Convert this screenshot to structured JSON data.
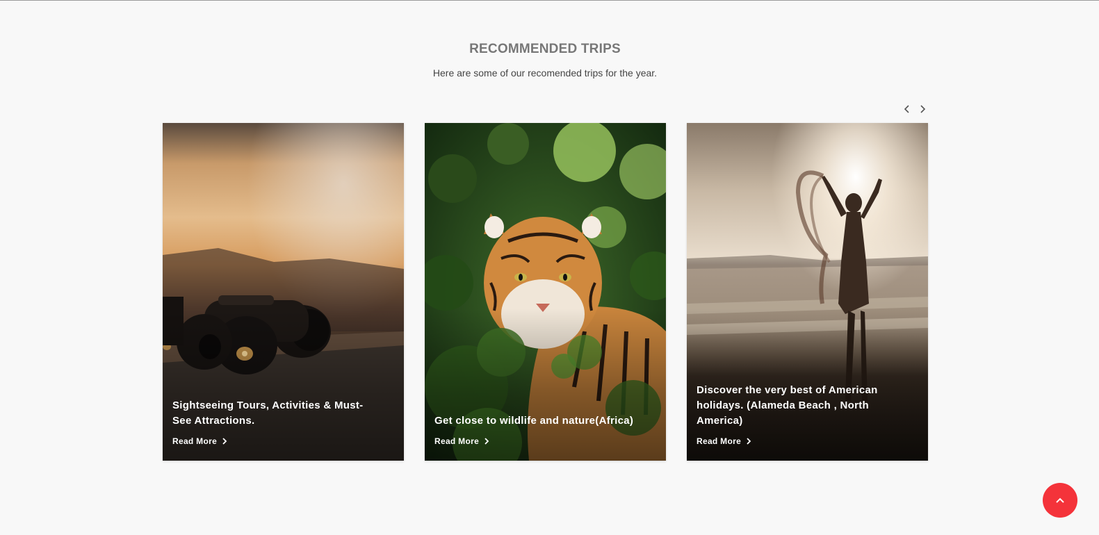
{
  "section": {
    "title": "RECOMMENDED TRIPS",
    "subtitle": "Here are some of our recomended trips for the year."
  },
  "carousel": {
    "prev_icon": "chevron-left-icon",
    "next_icon": "chevron-right-icon"
  },
  "cards": [
    {
      "title": "Sightseeing Tours, Activities & Must-See Attractions.",
      "link_label": "Read More",
      "image": "binoculars-on-ledge-at-sunset"
    },
    {
      "title": "Get close to wildlife and nature(Africa)",
      "link_label": "Read More",
      "image": "tiger-in-jungle-foliage"
    },
    {
      "title": "Discover the very best of American holidays. (Alameda Beach , North America)",
      "link_label": "Read More",
      "image": "woman-with-scarf-on-beach-at-sunset"
    }
  ],
  "back_to_top": {
    "icon": "chevron-up-icon",
    "color": "#f4333a"
  }
}
